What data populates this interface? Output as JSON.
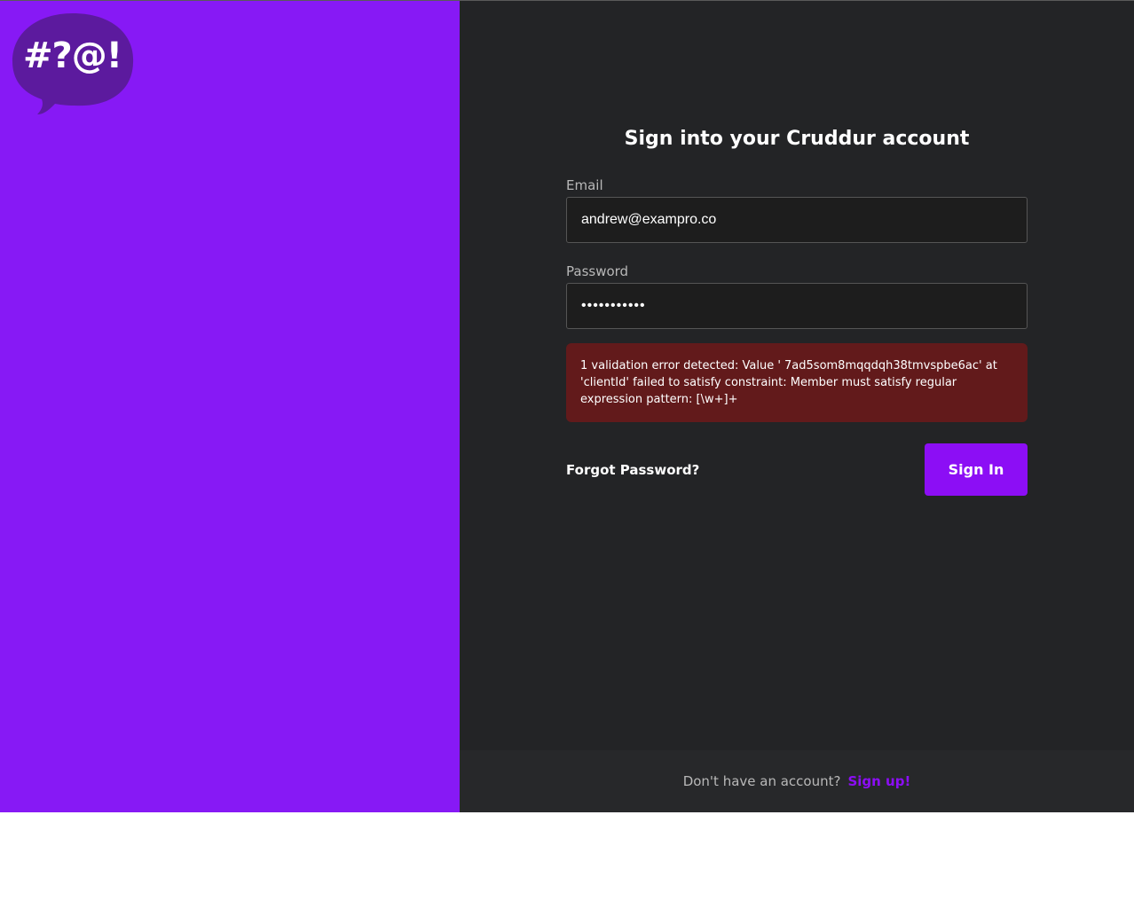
{
  "brand": {
    "logo_text": "#?@!",
    "logo_bubble_color": "#5c1a9e",
    "panel_color": "#8719f5"
  },
  "form": {
    "title": "Sign into your Cruddur account",
    "email_label": "Email",
    "email_value": "andrew@exampro.co",
    "password_label": "Password",
    "password_value": "secretpass1",
    "error_message": "1 validation error detected: Value ' 7ad5som8mqqdqh38tmvspbe6ac' at 'clientId' failed to satisfy constraint: Member must satisfy regular expression pattern: [\\w+]+",
    "forgot_label": "Forgot Password?",
    "signin_label": "Sign In"
  },
  "footer": {
    "prompt": "Don't have an account?",
    "signup_label": "Sign up!"
  },
  "colors": {
    "accent": "#8c0ef5",
    "form_background": "#232426",
    "error_background": "#621a1b"
  }
}
